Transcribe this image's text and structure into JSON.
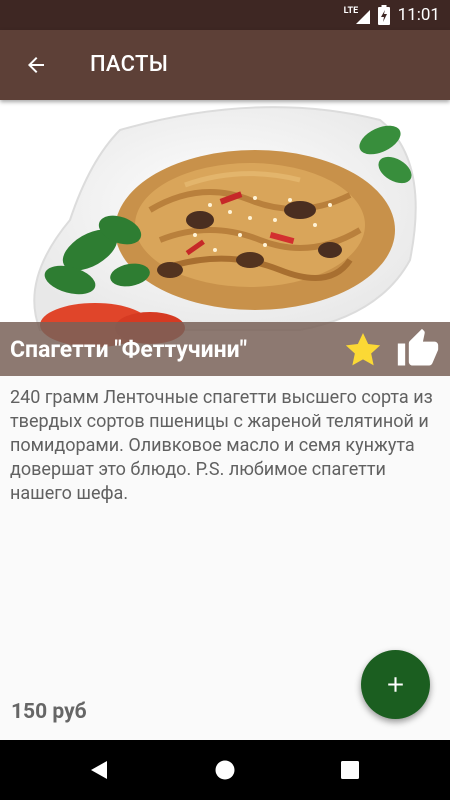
{
  "status_bar": {
    "network_label": "LTE",
    "time": "11:01",
    "icons": [
      "signal-icon",
      "battery-charging-icon"
    ]
  },
  "app_bar": {
    "title": "ПАСТЫ",
    "back_icon": "arrow-back-icon"
  },
  "dish": {
    "title": "Спагетти \"Феттучини\"",
    "image": "fettuccine-with-veal-and-sesame",
    "favorite_icon": "star-icon",
    "like_icon": "thumbs-up-icon",
    "description": "240 грамм  Ленточные спагетти высшего сорта из твердых сортов пшеницы с жареной телятиной и помидорами.  Оливковое масло и семя кунжута довершат это блюдо. P.S. любимое спагетти нашего шефа.",
    "price": "150 руб"
  },
  "fab": {
    "icon": "plus-icon"
  },
  "nav_bar": {
    "icons": [
      "back-triangle-icon",
      "home-circle-icon",
      "recents-square-icon"
    ]
  },
  "colors": {
    "status_bar": "#3e2723",
    "app_bar": "#5d4037",
    "title_band": "#796158",
    "fab": "#1b5e20",
    "star": "#fbd935",
    "background": "#fafafa"
  }
}
